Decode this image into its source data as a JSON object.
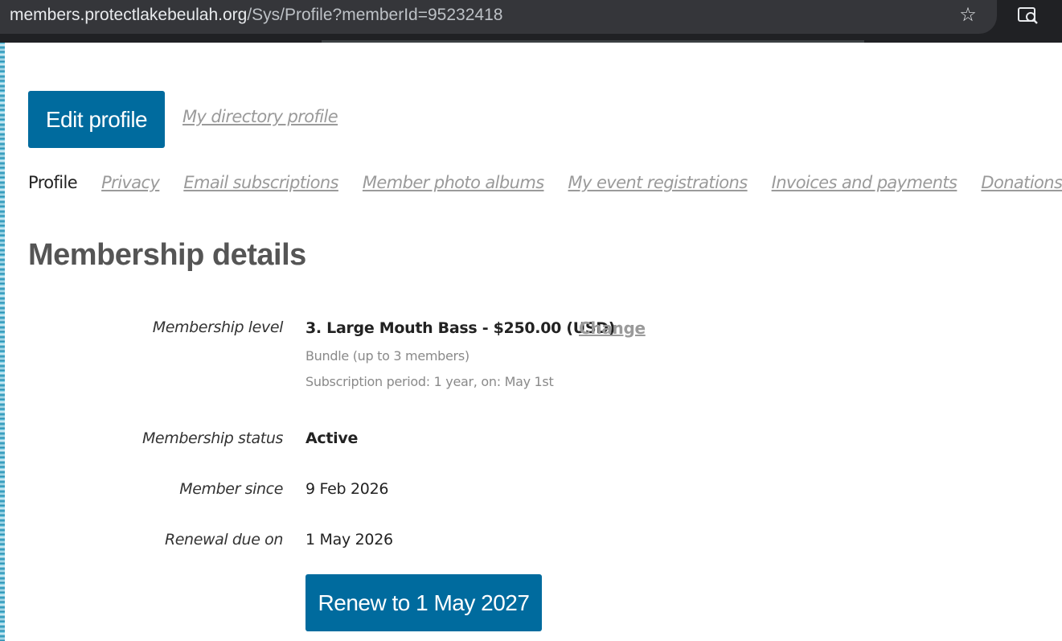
{
  "browser": {
    "url_host": "members.protectlakebeulah.org",
    "url_path": "/Sys/Profile?memberId=95232418",
    "star_icon": "star-icon",
    "lens_icon": "search-page-icon"
  },
  "header": {
    "edit_profile_label": "Edit profile",
    "directory_link_label": "My directory profile"
  },
  "tabs": [
    {
      "label": "Profile",
      "active": true
    },
    {
      "label": "Privacy",
      "active": false
    },
    {
      "label": "Email subscriptions",
      "active": false
    },
    {
      "label": "Member photo albums",
      "active": false
    },
    {
      "label": "My event registrations",
      "active": false
    },
    {
      "label": "Invoices and payments",
      "active": false
    },
    {
      "label": "Donations",
      "active": false
    }
  ],
  "membership": {
    "title": "Membership details",
    "level_label": "Membership level",
    "level_value": "3. Large Mouth Bass - $250.00 (USD)",
    "change_label": "Change",
    "bundle_note": "Bundle (up to 3 members)",
    "period_note": "Subscription period: 1 year, on: May 1st",
    "status_label": "Membership status",
    "status_value": "Active",
    "since_label": "Member since",
    "since_value": "9 Feb 2026",
    "renewal_label": "Renewal due on",
    "renewal_value": "1 May 2026",
    "renew_button_label": "Renew to 1 May 2027"
  },
  "colors": {
    "primary": "#006b9e",
    "link": "#9a9a9a",
    "chrome": "#202124"
  }
}
